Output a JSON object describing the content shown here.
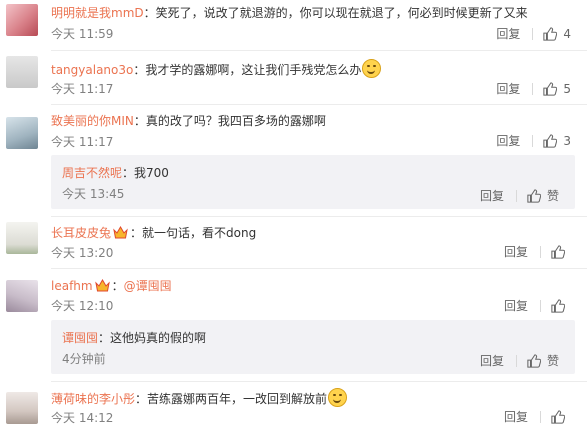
{
  "comments": [
    {
      "user": "明明就是我mmD",
      "sep": "：",
      "text": "笑死了，说改了就退游的，你可以现在就退了，何必到时候更新了又来",
      "time": "今天 11:59",
      "reply": "回复",
      "likes": "4"
    },
    {
      "user": "tangyalano3o",
      "sep": "：",
      "text": "我才学的露娜啊，这让我们手残党怎么办",
      "time": "今天 11:17",
      "reply": "回复",
      "likes": "5"
    },
    {
      "user": "致美丽的你MIN",
      "sep": "：",
      "text": "真的改了吗？我四百多场的露娜啊",
      "time": "今天 11:17",
      "reply": "回复",
      "likes": "3"
    },
    {
      "user": "长耳皮皮兔",
      "sep": "：",
      "text": "就一句话，看不dong",
      "time": "今天 13:20",
      "reply": "回复",
      "likes": ""
    },
    {
      "user": "leafhm",
      "sep": "：",
      "mention": "@谭囤囤",
      "text": "",
      "time": "今天 12:10",
      "reply": "回复",
      "likes": ""
    },
    {
      "user": "薄荷味的李小彤",
      "sep": "：",
      "text": "苦练露娜两百年，一改回到解放前",
      "time": "今天 14:12",
      "reply": "回复",
      "likes": ""
    }
  ],
  "replies": [
    {
      "user": "周吉不然呢",
      "sep": "：",
      "text": "我700",
      "time": "今天 13:45",
      "reply": "回复",
      "like": "赞"
    },
    {
      "user": "谭囤囤",
      "sep": "：",
      "text": "这他妈真的假的啊",
      "time": "4分钟前",
      "reply": "回复",
      "like": "赞"
    }
  ],
  "icons": {
    "like": "thumbs-up-icon",
    "emoji": "smile-emoji-icon",
    "badge": "member-badge-icon"
  },
  "colors": {
    "username": "#eb7350",
    "text": "#333333",
    "meta": "#808080",
    "reply_bg": "#f2f2f5"
  }
}
